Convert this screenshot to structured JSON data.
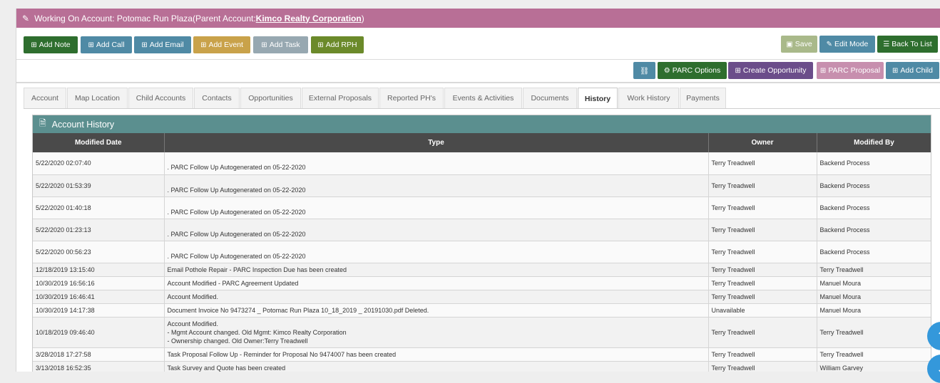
{
  "header": {
    "prefix": "Working On Account: Potomac Run Plaza(Parent Account: ",
    "parent_link": "Kimco Realty Corporation",
    "suffix": ")"
  },
  "actions": {
    "add_note": "Add Note",
    "add_call": "Add Call",
    "add_email": "Add Email",
    "add_event": "Add Event",
    "add_task": "Add Task",
    "add_rph": "Add RPH",
    "save": "Save",
    "edit_mode": "Edit Mode",
    "back_to_list": "Back To List",
    "parc_options": "PARC Options",
    "create_opportunity": "Create Opportunity",
    "parc_proposal": "PARC Proposal",
    "add_child": "Add Child"
  },
  "tabs": [
    "Account",
    "Map Location",
    "Child Accounts",
    "Contacts",
    "Opportunities",
    "External Proposals",
    "Reported PH's",
    "Events & Activities",
    "Documents",
    "History",
    "Work History",
    "Payments"
  ],
  "active_tab": "History",
  "panel": {
    "title": "Account History",
    "columns": [
      "Modified Date",
      "Type",
      "Owner",
      "Modified By"
    ]
  },
  "rows": [
    {
      "date": "5/22/2020 02:07:40",
      "type": ". PARC Follow Up Autogenerated on 05-22-2020",
      "owner": "Terry Treadwell",
      "by": "Backend Process"
    },
    {
      "date": "5/22/2020 01:53:39",
      "type": ". PARC Follow Up Autogenerated on 05-22-2020",
      "owner": "Terry Treadwell",
      "by": "Backend Process"
    },
    {
      "date": "5/22/2020 01:40:18",
      "type": ". PARC Follow Up Autogenerated on 05-22-2020",
      "owner": "Terry Treadwell",
      "by": "Backend Process"
    },
    {
      "date": "5/22/2020 01:23:13",
      "type": ". PARC Follow Up Autogenerated on 05-22-2020",
      "owner": "Terry Treadwell",
      "by": "Backend Process"
    },
    {
      "date": "5/22/2020 00:56:23",
      "type": ". PARC Follow Up Autogenerated on 05-22-2020",
      "owner": "Terry Treadwell",
      "by": "Backend Process"
    },
    {
      "date": "12/18/2019 13:15:40",
      "type": "Email Pothole Repair - PARC Inspection Due has been created",
      "owner": "Terry Treadwell",
      "by": "Terry Treadwell"
    },
    {
      "date": "10/30/2019 16:56:16",
      "type": "Account Modified - PARC Agreement Updated",
      "owner": "Terry Treadwell",
      "by": "Manuel Moura"
    },
    {
      "date": "10/30/2019 16:46:41",
      "type": "Account Modified.",
      "owner": "Terry Treadwell",
      "by": "Manuel Moura"
    },
    {
      "date": "10/30/2019 14:17:38",
      "type": "Document Invoice No 9473274 _ Potomac Run Plaza 10_18_2019 _ 20191030.pdf Deleted.",
      "owner": "Unavailable",
      "by": "Manuel Moura"
    },
    {
      "date": "10/18/2019 09:46:40",
      "type_lines": [
        "Account Modified.",
        "- Mgmt Account changed. Old Mgmt: Kimco Realty Corporation",
        "- Ownership changed. Old Owner:Terry Treadwell"
      ],
      "owner": "Terry Treadwell",
      "by": "Terry Treadwell"
    },
    {
      "date": "3/28/2018 17:27:58",
      "type": "Task Proposal Follow Up - Reminder for Proposal No 9474007 has been created",
      "owner": "Terry Treadwell",
      "by": "Terry Treadwell"
    },
    {
      "date": "3/13/2018 16:52:35",
      "type": "Task Survey and Quote has been created",
      "owner": "Terry Treadwell",
      "by": "William Garvey"
    }
  ]
}
